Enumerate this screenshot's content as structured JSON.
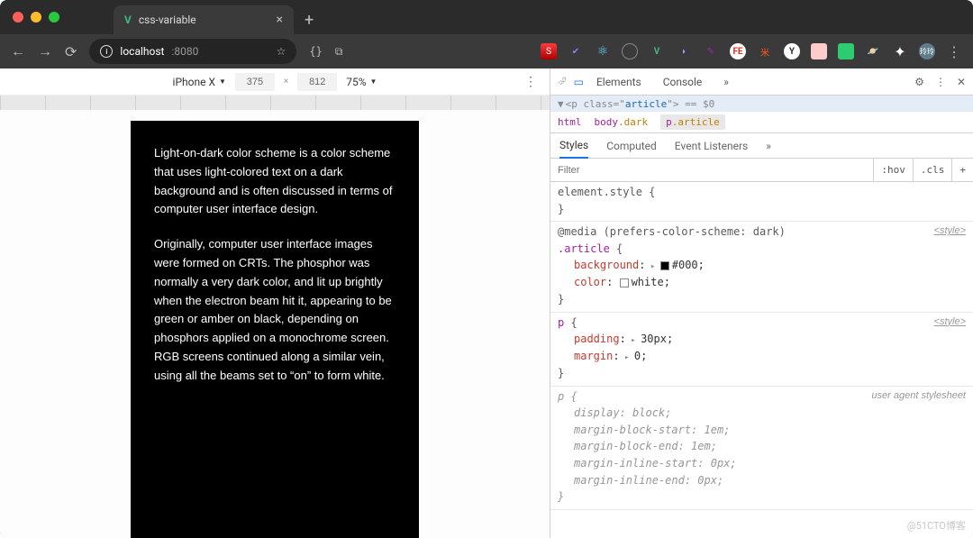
{
  "browser": {
    "tab_title": "css-variable",
    "url_host": "localhost",
    "url_port": ":8080"
  },
  "device_bar": {
    "device_name": "iPhone X",
    "width": "375",
    "height": "812",
    "zoom": "75%"
  },
  "article": {
    "p1": "Light-on-dark color scheme is a color scheme that uses light-colored text on a dark background and is often discussed in terms of computer user interface design.",
    "p2": "Originally, computer user interface images were formed on CRTs. The phosphor was normally a very dark color, and lit up brightly when the electron beam hit it, appearing to be green or amber on black, depending on phosphors applied on a monochrome screen. RGB screens continued along a similar vein, using all the beams set to “on” to form white."
  },
  "devtools": {
    "top_tabs": {
      "elements": "Elements",
      "console": "Console",
      "more": "»"
    },
    "element_snippet_raw": "<p class=\"article\"> == $0",
    "breadcrumb": [
      {
        "kind": "tag",
        "text": "html"
      },
      {
        "kind": "tagclass",
        "tag": "body",
        "cls": ".dark"
      },
      {
        "kind": "tagclass",
        "tag": "p",
        "cls": ".article",
        "selected": true
      }
    ],
    "style_tabs": {
      "styles": "Styles",
      "computed": "Computed",
      "events": "Event Listeners",
      "more": "»"
    },
    "filter_placeholder": "Filter",
    "filter_opts": {
      "hov": ":hov",
      "cls": ".cls",
      "plus": "+"
    },
    "rules": {
      "inline": {
        "selector": "element.style"
      },
      "article": {
        "media": "@media (prefers-color-scheme: dark)",
        "selector": ".article",
        "source": "<style>",
        "props": [
          {
            "name": "background",
            "value": "#000",
            "swatch": "#000",
            "expand": true
          },
          {
            "name": "color",
            "value": "white",
            "swatch": "#fff"
          }
        ]
      },
      "p_auth": {
        "selector": "p",
        "source": "<style>",
        "props": [
          {
            "name": "padding",
            "value": "30px",
            "expand": true
          },
          {
            "name": "margin",
            "value": "0",
            "expand": true
          }
        ]
      },
      "p_ua": {
        "selector": "p",
        "source": "user agent stylesheet",
        "props": [
          {
            "name": "display",
            "value": "block"
          },
          {
            "name": "margin-block-start",
            "value": "1em"
          },
          {
            "name": "margin-block-end",
            "value": "1em"
          },
          {
            "name": "margin-inline-start",
            "value": "0px"
          },
          {
            "name": "margin-inline-end",
            "value": "0px"
          }
        ]
      }
    }
  },
  "watermark": "@51CTO博客"
}
